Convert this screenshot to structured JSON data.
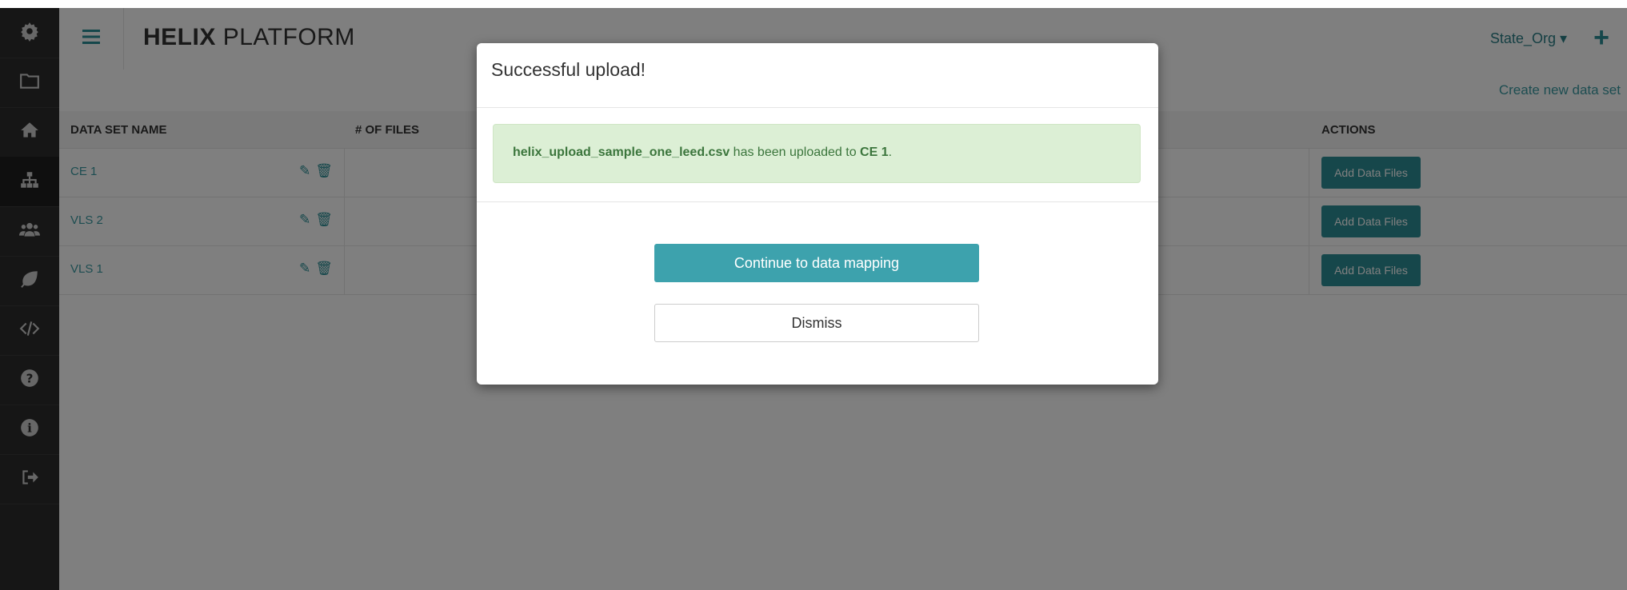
{
  "app": {
    "brand_bold": "HELIX",
    "brand_light": " PLATFORM",
    "org_selector": "State_Org ▾",
    "add_icon": "+"
  },
  "sidebar": {
    "items": [
      {
        "icon": "gear-icon"
      },
      {
        "icon": "folder-icon"
      },
      {
        "icon": "home-icon"
      },
      {
        "icon": "sitemap-icon",
        "active": true
      },
      {
        "icon": "users-icon"
      },
      {
        "icon": "leaf-icon"
      },
      {
        "icon": "code-icon"
      },
      {
        "icon": "question-icon"
      },
      {
        "icon": "info-icon"
      },
      {
        "icon": "sign-out-icon"
      }
    ]
  },
  "toolbar": {
    "create_link": "Create new data set"
  },
  "table": {
    "headers": {
      "name": "DATA SET NAME",
      "files": "# OF FILES",
      "actions": "ACTIONS"
    },
    "rows": [
      {
        "name": "CE 1",
        "action": "Add Data Files"
      },
      {
        "name": "VLS 2",
        "action": "Add Data Files"
      },
      {
        "name": "VLS 1",
        "action": "Add Data Files"
      }
    ]
  },
  "modal": {
    "title": "Successful upload!",
    "file_name": "helix_upload_sample_one_leed.csv",
    "message_mid": " has been uploaded to ",
    "dataset": "CE 1",
    "message_end": ".",
    "primary_button": "Continue to data mapping",
    "secondary_button": "Dismiss"
  },
  "colors": {
    "sidebar_bg": "#2d2d2d",
    "accent": "#2d8f96",
    "primary_button": "#3da2ad",
    "alert_bg": "#dcefd5",
    "alert_text": "#3c763d"
  }
}
